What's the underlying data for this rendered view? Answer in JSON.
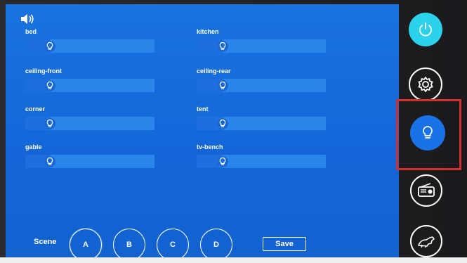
{
  "lights": [
    {
      "label": "bed",
      "level": 0.19
    },
    {
      "label": "kitchen",
      "level": 0.2
    },
    {
      "label": "ceiling-front",
      "level": 0.19
    },
    {
      "label": "ceiling-rear",
      "level": 0.2
    },
    {
      "label": "corner",
      "level": 0.19
    },
    {
      "label": "tent",
      "level": 0.2
    },
    {
      "label": "gable",
      "level": 0.19
    },
    {
      "label": "tv-bench",
      "level": 0.2
    }
  ],
  "scene": {
    "label": "Scene",
    "buttons": [
      "A",
      "B",
      "C",
      "D"
    ],
    "active": "A",
    "save_label": "Save"
  },
  "sidebar": {
    "items": [
      {
        "name": "power",
        "icon": "power-icon",
        "active": true
      },
      {
        "name": "settings",
        "icon": "gear-icon"
      },
      {
        "name": "lights",
        "icon": "lightbulb-icon",
        "selected": true
      },
      {
        "name": "radio",
        "icon": "radio-icon"
      },
      {
        "name": "pet",
        "icon": "pet-icon"
      }
    ]
  },
  "colors": {
    "screen": "#1a73e0",
    "accent_power": "#2ad2ec",
    "highlight": "#d62d2d"
  }
}
